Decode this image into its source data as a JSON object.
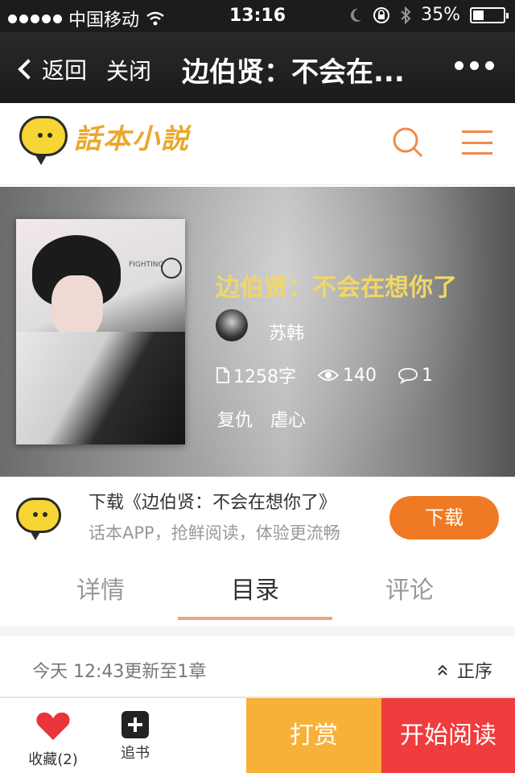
{
  "status_bar": {
    "carrier": "中国移动",
    "time": "13:16",
    "battery_text": "35%",
    "battery_level": 0.35
  },
  "nav": {
    "back_label": "返回",
    "close_label": "关闭",
    "title": "边伯贤：不会在..."
  },
  "app_header": {
    "logo_text": "話本小説"
  },
  "book": {
    "cover_text": "FIGHTING",
    "title": "边伯贤：不会在想你了",
    "author": "苏韩",
    "word_count": "1258字",
    "views": "140",
    "comments": "1",
    "tags": [
      "复仇",
      "虐心"
    ]
  },
  "download_banner": {
    "line1": "下载《边伯贤：不会在想你了》",
    "line2": "话本APP，抢鲜阅读，体验更流畅",
    "button_label": "下载"
  },
  "tabs": [
    {
      "label": "详情"
    },
    {
      "label": "目录"
    },
    {
      "label": "评论"
    }
  ],
  "catalog": {
    "update_text": "今天 12:43更新至1章",
    "sort_label": "正序"
  },
  "bottom_bar": {
    "favorite_label": "收藏(2)",
    "follow_label": "追书",
    "reward_label": "打赏",
    "read_label": "开始阅读"
  },
  "colors": {
    "accent_orange": "#f07a23",
    "title_yellow": "#f1d764",
    "reward_bg": "#f7b139",
    "read_bg": "#f03c3c",
    "tab_indicator": "#f0a283"
  }
}
